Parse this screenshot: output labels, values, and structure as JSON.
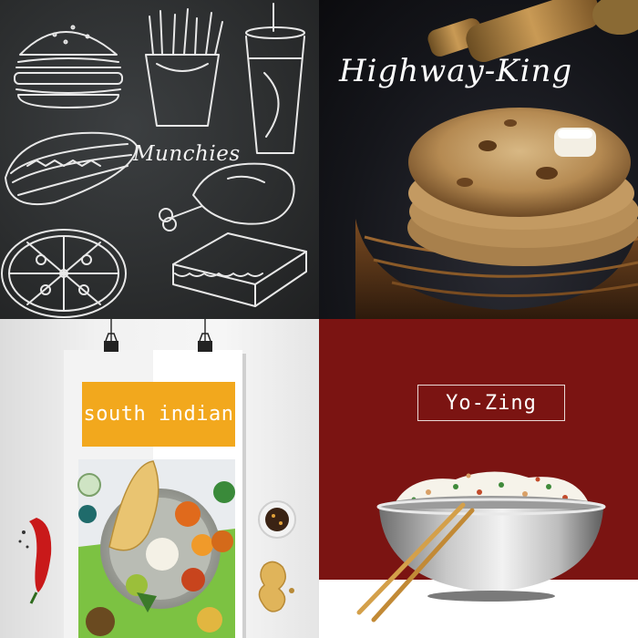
{
  "tiles": [
    {
      "label": "Munchies",
      "theme": "chalkboard",
      "bg": "#2f3132"
    },
    {
      "label": "Highway-King",
      "theme": "paratha",
      "bg": "#14151a"
    },
    {
      "label": "south indian",
      "theme": "poster",
      "bg": "#efefef",
      "accent": "#f2a81d"
    },
    {
      "label": "Yo-Zing",
      "theme": "fried-rice",
      "bg": "#7b1412"
    }
  ]
}
